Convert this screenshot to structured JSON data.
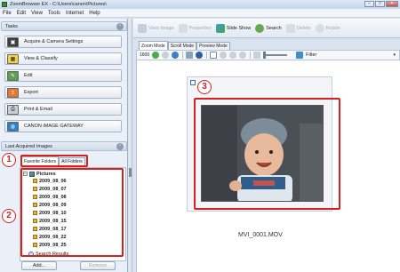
{
  "window": {
    "title": "ZoomBrowser EX - C:\\Users\\canon\\Pictures\\"
  },
  "menu": [
    "File",
    "Edit",
    "View",
    "Tools",
    "Internet",
    "Help"
  ],
  "tasks": {
    "header": "Tasks",
    "buttons": [
      {
        "label": "Acquire & Camera Settings",
        "icon": "camera-icon"
      },
      {
        "label": "View & Classify",
        "icon": "view-classify-icon"
      },
      {
        "label": "Edit",
        "icon": "edit-icon"
      },
      {
        "label": "Export",
        "icon": "export-icon"
      },
      {
        "label": "Print & Email",
        "icon": "print-icon"
      },
      {
        "label": "CANON iMAGE GATEWAY",
        "icon": "gateway-icon"
      }
    ]
  },
  "last_acquired": {
    "header": "Last Acquired Images"
  },
  "folder_tabs": [
    "Favorite Folders",
    "All Folders"
  ],
  "tree": {
    "root": "Pictures",
    "folders": [
      "2009_08_06",
      "2009_08_07",
      "2009_08_08",
      "2009_08_09",
      "2009_08_10",
      "2009_08_15",
      "2009_08_17",
      "2009_08_22",
      "2009_08_25"
    ],
    "search": "Search Results"
  },
  "left_buttons": {
    "add": "Add...",
    "remove": "Remove"
  },
  "toolbar": {
    "view_image": "View Image",
    "properties": "Properties",
    "slide_show": "Slide Show",
    "search": "Search",
    "delete": "Delete",
    "rotate": "Rotate"
  },
  "view_tabs": [
    "Zoom Mode",
    "Scroll Mode",
    "Preview Mode"
  ],
  "subtoolbar": {
    "number": "1600",
    "filter": "Filter"
  },
  "callouts": [
    "1",
    "2",
    "3"
  ],
  "thumbnail": {
    "filename": "MVI_0001.MOV"
  },
  "colors": {
    "callout": "#d92020",
    "window_bg": "#d9e3ef"
  }
}
